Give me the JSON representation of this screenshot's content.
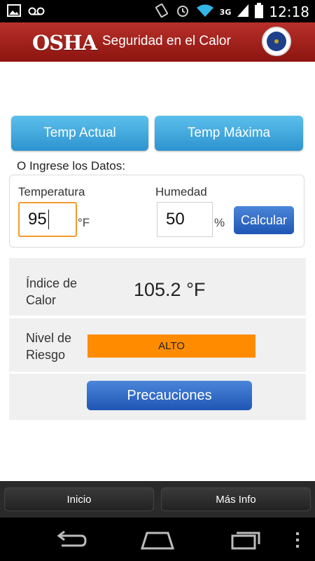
{
  "status_bar": {
    "time": "12:18",
    "network": "3G",
    "icons": [
      "image-icon",
      "voicemail-icon",
      "vibrate-icon",
      "alarm-icon",
      "wifi-icon",
      "signal-icon",
      "battery-icon"
    ]
  },
  "header": {
    "logo_text": "OSHA",
    "title": "Seguridad en el Calor",
    "seal_icon": "dol-seal-icon"
  },
  "buttons": {
    "temp_actual": "Temp Actual",
    "temp_maxima": "Temp Máxima"
  },
  "input_prompt": "O Ingrese los Datos:",
  "inputs": {
    "temperature_label": "Temperatura",
    "temperature_value": "95",
    "temperature_unit": "°F",
    "humidity_label": "Humedad",
    "humidity_value": "50",
    "humidity_unit": "%",
    "calculate_label": "Calcular"
  },
  "results": {
    "heat_index_label": "Índice de Calor",
    "heat_index_value": "105.2 °F",
    "risk_label": "Nivel de Riesgo",
    "risk_value": "ALTO",
    "risk_color": "#ff8c00",
    "precautions_label": "Precauciones"
  },
  "tabs": {
    "home": "Inicio",
    "more_info": "Más Info"
  },
  "nav": {
    "icons": [
      "back-icon",
      "home-icon",
      "recent-apps-icon",
      "overflow-menu-icon"
    ]
  },
  "colors": {
    "header_red": "#a3221c",
    "button_blue": "#2d93cf",
    "focus_orange": "#f29a2e"
  }
}
